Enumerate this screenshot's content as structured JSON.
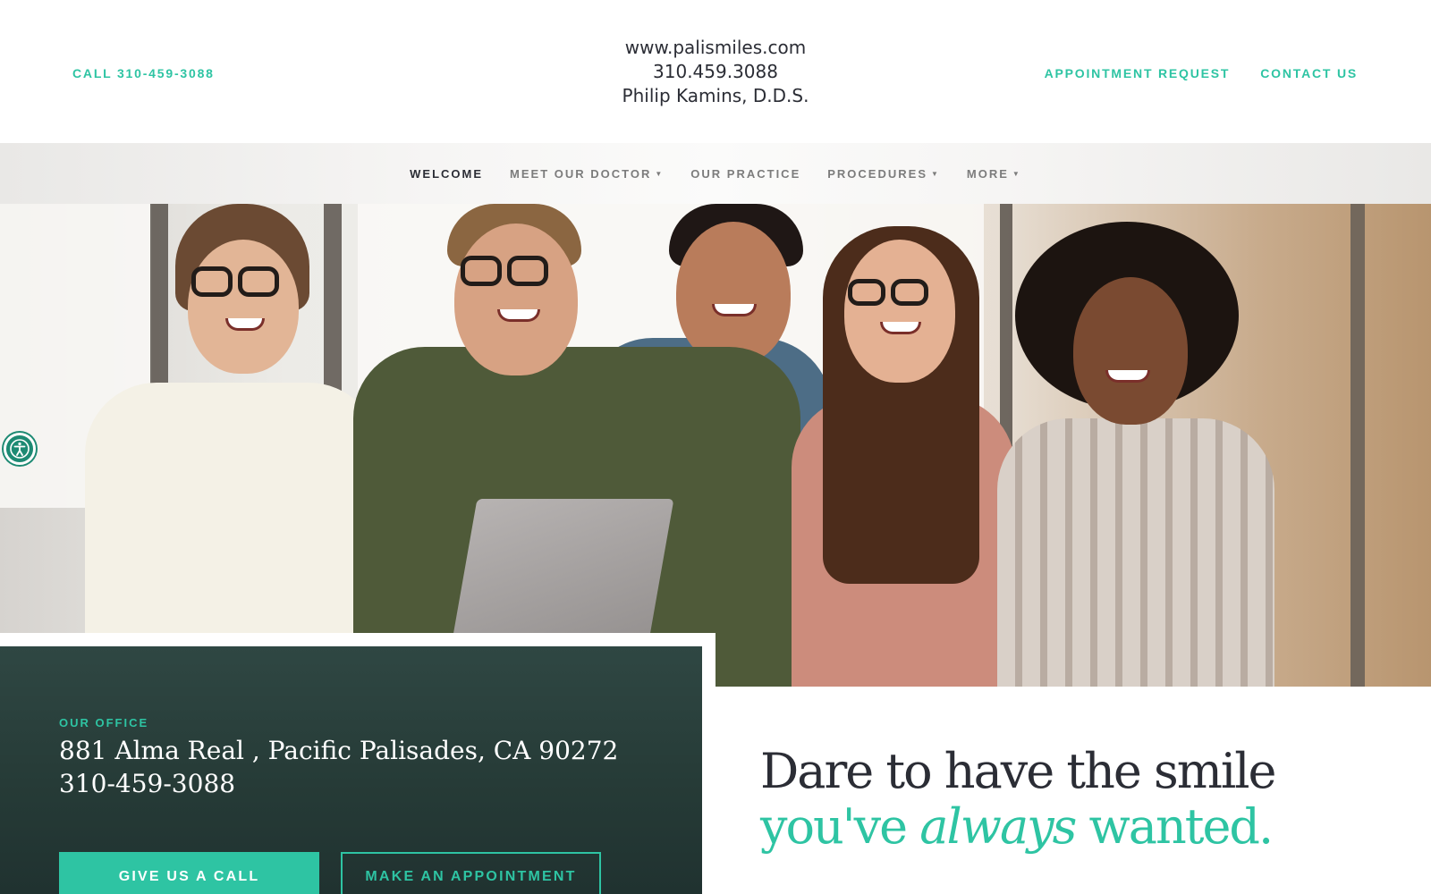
{
  "header": {
    "call_label": "CALL 310-459-3088",
    "site_url": "www.palismiles.com",
    "phone": "310.459.3088",
    "doctor": "Philip Kamins, D.D.S.",
    "links": [
      "APPOINTMENT REQUEST",
      "CONTACT US"
    ]
  },
  "nav": {
    "items": [
      {
        "label": "WELCOME",
        "dropdown": false,
        "active": true
      },
      {
        "label": "MEET OUR DOCTOR",
        "dropdown": true,
        "active": false
      },
      {
        "label": "OUR PRACTICE",
        "dropdown": false,
        "active": false
      },
      {
        "label": "PROCEDURES",
        "dropdown": true,
        "active": false
      },
      {
        "label": "MORE",
        "dropdown": true,
        "active": false
      }
    ]
  },
  "hero": {
    "image": "group-of-five-smiling-people",
    "accessibility_icon": "accessibility-icon"
  },
  "office": {
    "label": "OUR OFFICE",
    "address": "881 Alma Real , Pacific Palisades, CA 90272",
    "phone": "310-459-3088",
    "primary_button": "GIVE US A CALL",
    "secondary_button": "MAKE AN APPOINTMENT"
  },
  "headline": {
    "line1": "Dare to have the smile",
    "line2_start": "you've ",
    "line2_emphasis": "always",
    "line2_end": " wanted."
  },
  "colors": {
    "accent": "#2ec4a3",
    "dark_text": "#2b2d35",
    "card_bg": "#263b37"
  }
}
